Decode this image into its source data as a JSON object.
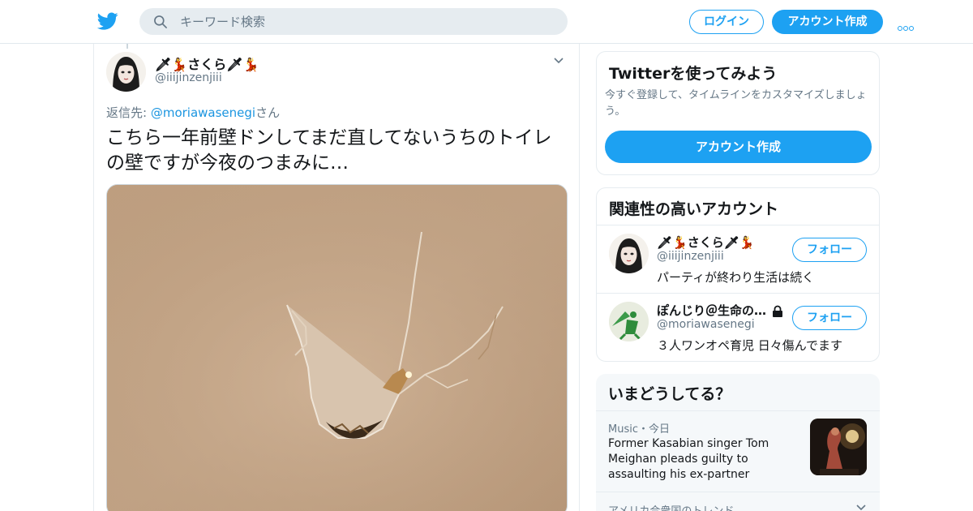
{
  "header": {
    "logo_icon": "twitter-bird-icon",
    "search_placeholder": "キーワード検索",
    "login_label": "ログイン",
    "signup_label": "アカウント作成",
    "more_icon": "more-dots-icon",
    "accent": "#1da1f2"
  },
  "tweet": {
    "display_name": "🗡💃さくら🗡💃",
    "handle": "@iiijinzenjiii",
    "reply_prefix": "返信先: ",
    "reply_mention": "@moriawasenegi",
    "reply_suffix": "さん",
    "text": "こちら一年前壁ドンしてまだ直してないうちのトイレの壁ですが今夜のつまみに…"
  },
  "sidebar": {
    "signup_card": {
      "title": "Twitterを使ってみよう",
      "description": "今すぐ登録して、タイムラインをカスタマイズしましょう。",
      "button_label": "アカウント作成"
    },
    "related": {
      "title": "関連性の高いアカウント",
      "accounts": [
        {
          "name": "🗡💃さくら🗡💃",
          "handle": "@iiijinzenjiii",
          "bio": "パーティが終わり生活は続く",
          "follow_label": "フォロー"
        },
        {
          "name": "ぽんじり＠生命の…",
          "handle": "@moriawasenegi",
          "bio": "３人ワンオペ育児 日々傷んでます",
          "follow_label": "フォロー",
          "protected": true
        }
      ]
    },
    "trends": {
      "title": "いまどうしてる？",
      "item": {
        "meta": "Music・今日",
        "headline": "Former Kasabian singer Tom Meighan pleads guilty to assaulting his ex-partner"
      },
      "next_label": "アメリカ合衆国のトレンド"
    }
  }
}
